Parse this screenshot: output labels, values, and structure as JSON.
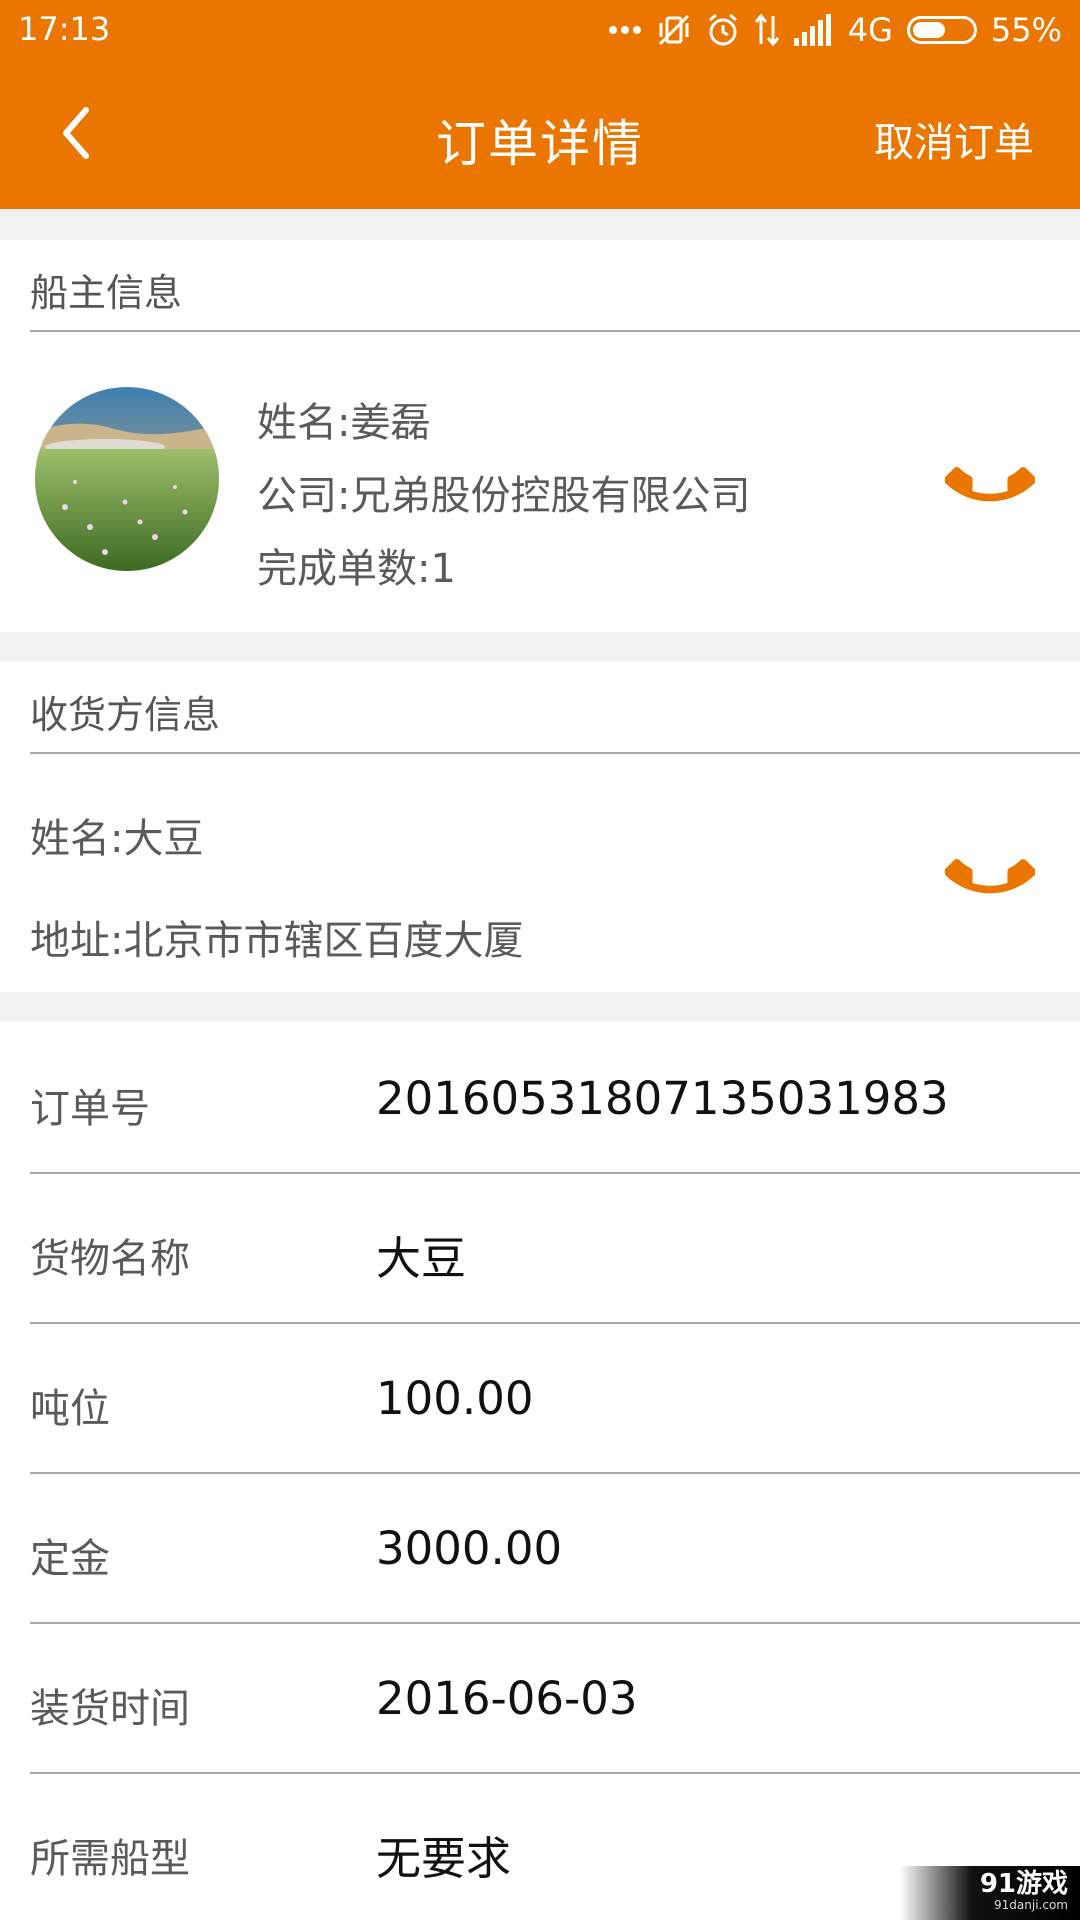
{
  "status_bar": {
    "time": "17:13",
    "network": "4G",
    "battery_percent_text": "55%",
    "battery_level": 0.55,
    "icons": [
      "more-dots-icon",
      "vibrate-off-icon",
      "alarm-icon",
      "data-arrows-icon",
      "signal-icon",
      "battery-icon"
    ]
  },
  "header": {
    "title": "订单详情",
    "action": "取消订单",
    "back_icon": "chevron-left-icon",
    "color": "#ea7600"
  },
  "owner": {
    "section_title": "船主信息",
    "name": "姓名:姜磊",
    "company": "公司:兄弟股份控股有限公司",
    "completed": "完成单数:1",
    "phone_icon": "phone-icon"
  },
  "receiver": {
    "section_title": "收货方信息",
    "name": "姓名:大豆",
    "address": "地址:北京市市辖区百度大厦",
    "phone_icon": "phone-icon"
  },
  "details": [
    {
      "label": "订单号",
      "value": "20160531807135031983"
    },
    {
      "label": "货物名称",
      "value": "大豆"
    },
    {
      "label": "吨位",
      "value": "100.00"
    },
    {
      "label": "定金",
      "value": "3000.00"
    },
    {
      "label": "装货时间",
      "value": "2016-06-03"
    },
    {
      "label": "所需船型",
      "value": "无要求"
    }
  ],
  "watermark": {
    "main": "91游戏",
    "sub": "91danji.com"
  }
}
